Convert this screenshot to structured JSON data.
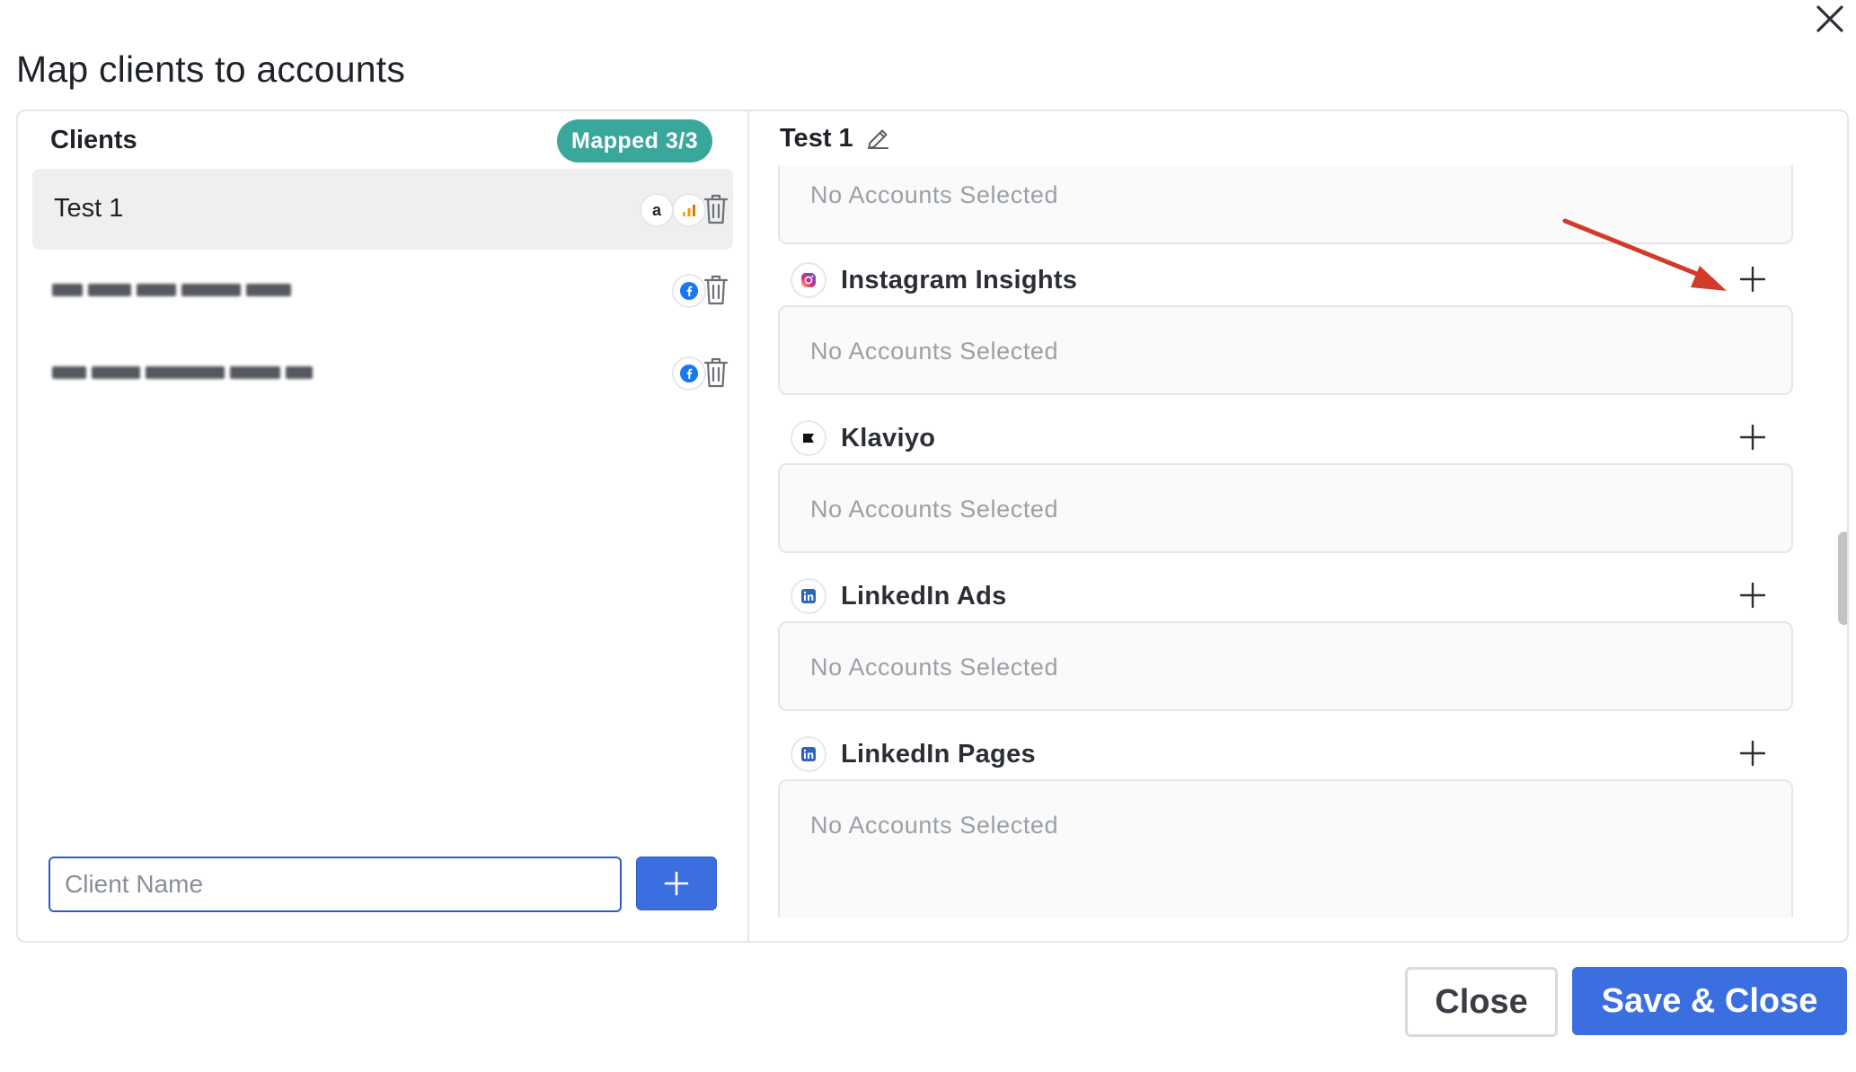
{
  "dialog": {
    "title": "Map clients to accounts",
    "close_icon": "close-icon"
  },
  "clients_panel": {
    "header": "Clients",
    "badge": "Mapped 3/3",
    "clients": [
      {
        "name": "Test 1",
        "blurred": false,
        "icons": [
          "amazon-icon",
          "google-analytics-icon"
        ],
        "selected": true
      },
      {
        "name": "",
        "blurred": true,
        "icons": [
          "facebook-icon"
        ],
        "selected": false
      },
      {
        "name": "",
        "blurred": true,
        "icons": [
          "facebook-icon"
        ],
        "selected": false
      }
    ],
    "input_placeholder": "Client Name",
    "input_value": ""
  },
  "detail_panel": {
    "client_title": "Test 1",
    "empty_label": "No Accounts Selected",
    "sections": [
      {
        "name": "Instagram Insights",
        "icon": "instagram-icon"
      },
      {
        "name": "Klaviyo",
        "icon": "klaviyo-icon"
      },
      {
        "name": "LinkedIn Ads",
        "icon": "linkedin-icon"
      },
      {
        "name": "LinkedIn Pages",
        "icon": "linkedin-icon"
      }
    ]
  },
  "footer": {
    "close_label": "Close",
    "save_label": "Save & Close"
  },
  "colors": {
    "accent_blue": "#3b6fe0",
    "badge_teal": "#3aa79c",
    "annotation_arrow": "#d23a2a"
  }
}
